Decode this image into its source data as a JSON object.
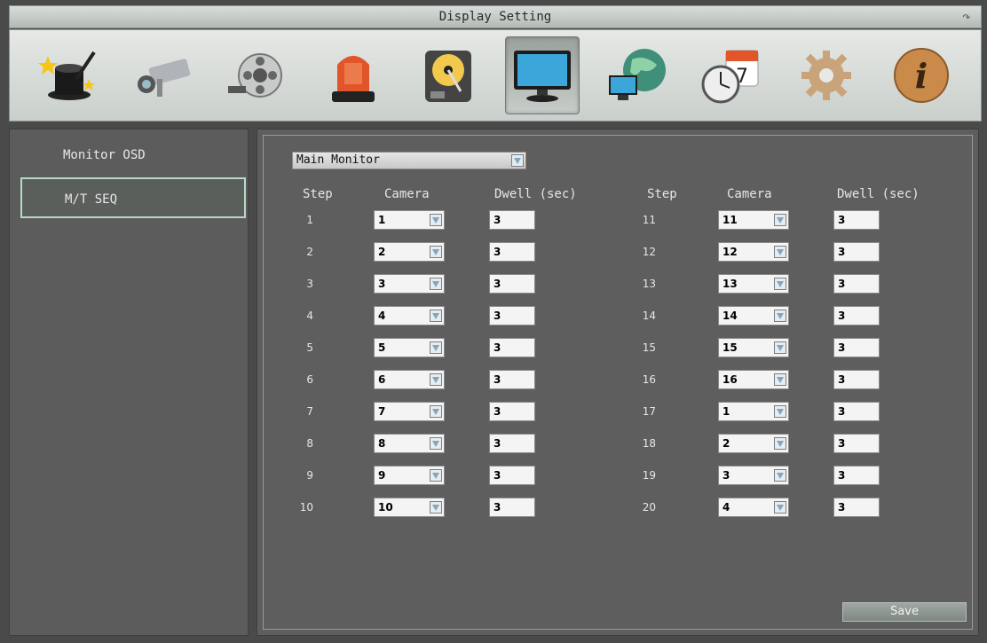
{
  "window": {
    "title": "Display Setting"
  },
  "toolbar": {
    "icons": [
      {
        "name": "wizard-icon",
        "active": false
      },
      {
        "name": "camera-icon",
        "active": false
      },
      {
        "name": "record-icon",
        "active": false
      },
      {
        "name": "alarm-icon",
        "active": false
      },
      {
        "name": "hdd-icon",
        "active": false
      },
      {
        "name": "display-icon",
        "active": true
      },
      {
        "name": "network-icon",
        "active": false
      },
      {
        "name": "schedule-icon",
        "active": false
      },
      {
        "name": "system-icon",
        "active": false
      },
      {
        "name": "info-icon",
        "active": false
      }
    ]
  },
  "sidebar": {
    "items": [
      {
        "label": "Monitor OSD",
        "active": false
      },
      {
        "label": "M/T SEQ",
        "active": true
      }
    ]
  },
  "main": {
    "monitor_select": "Main Monitor",
    "headers": {
      "step": "Step",
      "camera": "Camera",
      "dwell": "Dwell (sec)"
    },
    "left_rows": [
      {
        "step": "1",
        "camera": "1",
        "dwell": "3"
      },
      {
        "step": "2",
        "camera": "2",
        "dwell": "3"
      },
      {
        "step": "3",
        "camera": "3",
        "dwell": "3"
      },
      {
        "step": "4",
        "camera": "4",
        "dwell": "3"
      },
      {
        "step": "5",
        "camera": "5",
        "dwell": "3"
      },
      {
        "step": "6",
        "camera": "6",
        "dwell": "3"
      },
      {
        "step": "7",
        "camera": "7",
        "dwell": "3"
      },
      {
        "step": "8",
        "camera": "8",
        "dwell": "3"
      },
      {
        "step": "9",
        "camera": "9",
        "dwell": "3"
      },
      {
        "step": "10",
        "camera": "10",
        "dwell": "3"
      }
    ],
    "right_rows": [
      {
        "step": "11",
        "camera": "11",
        "dwell": "3"
      },
      {
        "step": "12",
        "camera": "12",
        "dwell": "3"
      },
      {
        "step": "13",
        "camera": "13",
        "dwell": "3"
      },
      {
        "step": "14",
        "camera": "14",
        "dwell": "3"
      },
      {
        "step": "15",
        "camera": "15",
        "dwell": "3"
      },
      {
        "step": "16",
        "camera": "16",
        "dwell": "3"
      },
      {
        "step": "17",
        "camera": "1",
        "dwell": "3"
      },
      {
        "step": "18",
        "camera": "2",
        "dwell": "3"
      },
      {
        "step": "19",
        "camera": "3",
        "dwell": "3"
      },
      {
        "step": "20",
        "camera": "4",
        "dwell": "3"
      }
    ],
    "save_label": "Save"
  }
}
